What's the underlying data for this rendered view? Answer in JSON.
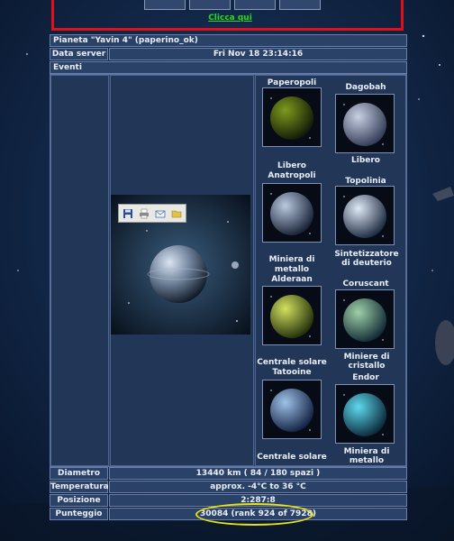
{
  "banner": {
    "link": "Clicca qui"
  },
  "header": {
    "planet_title": "Pianeta \"Yavin 4\" (paperino_ok)",
    "server_label": "Data server",
    "server_date": "Fri Nov 18 23:14:16",
    "events_label": "Eventi"
  },
  "toolbar": {
    "icons": [
      "save-icon",
      "print-icon",
      "email-icon",
      "folder-icon"
    ]
  },
  "planets": [
    {
      "name": "Paperopoli",
      "caption": "",
      "colors": [
        "#7e9a1e",
        "#0d1406"
      ]
    },
    {
      "name": "Dagobah",
      "caption": "Libero",
      "colors": [
        "#c9d0e3",
        "#2c3550"
      ]
    },
    {
      "name": "Libero\nAnatropoli",
      "caption": "",
      "colors": [
        "#b9c9df",
        "#101a2e"
      ]
    },
    {
      "name": "Topolinia",
      "caption": "Sintetizzatore di deuterio",
      "colors": [
        "#dfe9f7",
        "#142237"
      ]
    },
    {
      "name": "Miniera di metallo\nAlderaan",
      "caption": "",
      "colors": [
        "#d3e05e",
        "#1b2808"
      ]
    },
    {
      "name": "Coruscant",
      "caption": "Miniere di cristallo",
      "colors": [
        "#9fd0a8",
        "#0b2330"
      ]
    },
    {
      "name": "Centrale solare\nTatooine",
      "caption": "",
      "colors": [
        "#9fc2e8",
        "#0c1b3b"
      ]
    },
    {
      "name": "Endor",
      "caption": "Miniera di metallo",
      "colors": [
        "#5fd8ee",
        "#062131"
      ]
    },
    {
      "name": "",
      "caption": "Centrale solare",
      "colors": [
        "#000000",
        "#000000"
      ]
    }
  ],
  "stats": {
    "diameter_label": "Diametro",
    "diameter_value": "13440 km ( 84 / 180 spazi )",
    "temp_label": "Temperatura",
    "temp_value": "approx. -4°C to 36 °C",
    "pos_label": "Posizione",
    "pos_value": "2:287:8",
    "score_label": "Punteggio",
    "score_value": "30084 (rank 924 of 7928)"
  },
  "colors": {
    "highlight": "#e6e21a",
    "banner_border": "#e0101a",
    "link": "#22dd22"
  }
}
